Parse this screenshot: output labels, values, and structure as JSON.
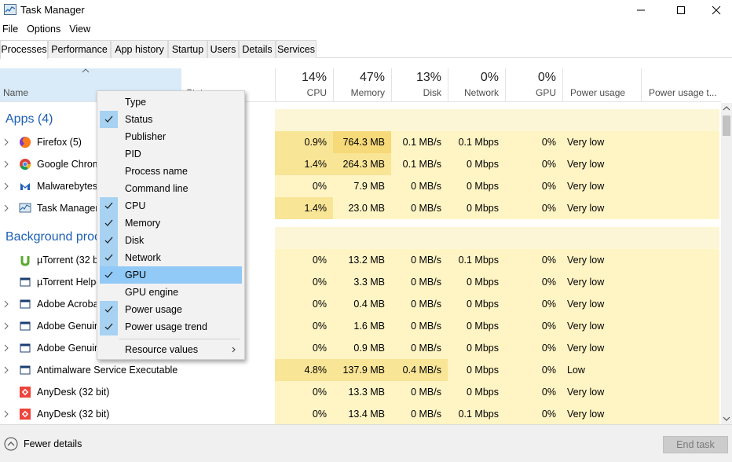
{
  "window": {
    "title": "Task Manager",
    "menu": [
      "File",
      "Options",
      "View"
    ]
  },
  "tabs": [
    "Processes",
    "Performance",
    "App history",
    "Startup",
    "Users",
    "Details",
    "Services"
  ],
  "header": {
    "name_label": "Name",
    "status_label": "Status",
    "cpu": {
      "pct": "14%",
      "label": "CPU"
    },
    "memory": {
      "pct": "47%",
      "label": "Memory"
    },
    "disk": {
      "pct": "13%",
      "label": "Disk"
    },
    "network": {
      "pct": "0%",
      "label": "Network"
    },
    "gpu": {
      "pct": "0%",
      "label": "GPU"
    },
    "power": {
      "label": "Power usage"
    },
    "power_trend": {
      "label": "Power usage t..."
    }
  },
  "groups": {
    "apps": "Apps (4)",
    "background": "Background proc"
  },
  "rows": [
    {
      "name": "Firefox (5)",
      "icon": "firefox-icon",
      "cpu": "0.9%",
      "memory": "764.3 MB",
      "disk": "0.1 MB/s",
      "network": "0.1 Mbps",
      "gpu": "0%",
      "power": "Very low"
    },
    {
      "name": "Google Chrom",
      "icon": "chrome-icon",
      "cpu": "1.4%",
      "memory": "264.3 MB",
      "disk": "0.1 MB/s",
      "network": "0 Mbps",
      "gpu": "0%",
      "power": "Very low"
    },
    {
      "name": "Malwarebytes",
      "icon": "malwarebytes-icon",
      "cpu": "0%",
      "memory": "7.9 MB",
      "disk": "0 MB/s",
      "network": "0 Mbps",
      "gpu": "0%",
      "power": "Very low"
    },
    {
      "name": "Task Manager",
      "icon": "task-manager-icon",
      "cpu": "1.4%",
      "memory": "23.0 MB",
      "disk": "0 MB/s",
      "network": "0 Mbps",
      "gpu": "0%",
      "power": "Very low"
    },
    {
      "name": "µTorrent (32 bi",
      "icon": "utorrent-icon",
      "cpu": "0%",
      "memory": "13.2 MB",
      "disk": "0 MB/s",
      "network": "0.1 Mbps",
      "gpu": "0%",
      "power": "Very low"
    },
    {
      "name": "µTorrent Helpe",
      "icon": "window-icon",
      "cpu": "0%",
      "memory": "3.3 MB",
      "disk": "0 MB/s",
      "network": "0 Mbps",
      "gpu": "0%",
      "power": "Very low"
    },
    {
      "name": "Adobe Acroba",
      "icon": "window-icon",
      "cpu": "0%",
      "memory": "0.4 MB",
      "disk": "0 MB/s",
      "network": "0 Mbps",
      "gpu": "0%",
      "power": "Very low"
    },
    {
      "name": "Adobe Genuin",
      "icon": "window-icon",
      "cpu": "0%",
      "memory": "1.6 MB",
      "disk": "0 MB/s",
      "network": "0 Mbps",
      "gpu": "0%",
      "power": "Very low"
    },
    {
      "name": "Adobe Genuin",
      "icon": "window-icon",
      "cpu": "0%",
      "memory": "0.9 MB",
      "disk": "0 MB/s",
      "network": "0 Mbps",
      "gpu": "0%",
      "power": "Very low"
    },
    {
      "name": "Antimalware Service Executable",
      "icon": "window-icon",
      "cpu": "4.8%",
      "memory": "137.9 MB",
      "disk": "0.4 MB/s",
      "network": "0 Mbps",
      "gpu": "0%",
      "power": "Low"
    },
    {
      "name": "AnyDesk (32 bit)",
      "icon": "anydesk-icon",
      "cpu": "0%",
      "memory": "13.3 MB",
      "disk": "0 MB/s",
      "network": "0 Mbps",
      "gpu": "0%",
      "power": "Very low"
    },
    {
      "name": "AnyDesk (32 bit)",
      "icon": "anydesk-icon",
      "cpu": "0%",
      "memory": "13.4 MB",
      "disk": "0 MB/s",
      "network": "0.1 Mbps",
      "gpu": "0%",
      "power": "Very low"
    }
  ],
  "context_menu": {
    "items": [
      {
        "label": "Type",
        "checked": false
      },
      {
        "label": "Status",
        "checked": true
      },
      {
        "label": "Publisher",
        "checked": false
      },
      {
        "label": "PID",
        "checked": false
      },
      {
        "label": "Process name",
        "checked": false
      },
      {
        "label": "Command line",
        "checked": false
      },
      {
        "label": "CPU",
        "checked": true
      },
      {
        "label": "Memory",
        "checked": true
      },
      {
        "label": "Disk",
        "checked": true
      },
      {
        "label": "Network",
        "checked": true
      },
      {
        "label": "GPU",
        "checked": true,
        "highlighted": true
      },
      {
        "label": "GPU engine",
        "checked": false
      },
      {
        "label": "Power usage",
        "checked": true
      },
      {
        "label": "Power usage trend",
        "checked": true
      }
    ],
    "resource_values": "Resource values"
  },
  "footer": {
    "fewer_details": "Fewer details",
    "end_task": "End task"
  },
  "colors": {
    "heat_light": "#fff4c4",
    "heat_mid": "#ffedad",
    "heat_strong": "#f9e596",
    "empty_row": "#fff9e1",
    "accent": "#1a5fb4",
    "menu_highlight": "#91c9f7"
  }
}
